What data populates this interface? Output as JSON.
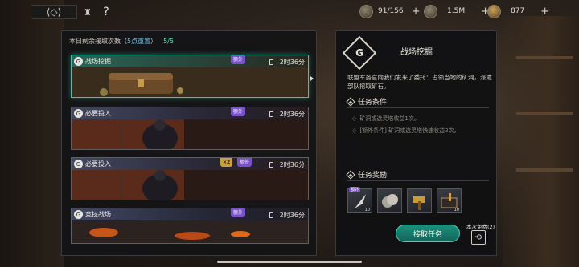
{
  "topbar": {
    "back_glyph": "⟨◇⟩",
    "home_glyph": "♜",
    "help_label": "?",
    "currencies": [
      {
        "value": "91/156",
        "icon": "energy-icon"
      },
      {
        "value": "1.5M",
        "icon": "silver-coin-icon"
      },
      {
        "value": "877",
        "icon": "gold-coin-icon"
      }
    ],
    "plus": "+"
  },
  "quota": {
    "prefix": "本日剩余接取次数（",
    "reset": "5点重置",
    "suffix": "）",
    "count": "5/5"
  },
  "missions": [
    {
      "title": "战场挖掘",
      "extra": "额外",
      "time": "2时36分",
      "active": true
    },
    {
      "title": "必要投入",
      "extra": "额外",
      "time": "2时36分",
      "active": false
    },
    {
      "title": "必要投入",
      "extra": "额外",
      "x2": "×2",
      "time": "2时36分",
      "active": false
    },
    {
      "title": "竞技战场",
      "extra": "额外",
      "time": "2时36分",
      "active": false
    }
  ],
  "detail": {
    "logo_letter": "G",
    "title": "战场挖掘",
    "description": "联盟军务官向我们发来了委托：占领当地的矿洞，派遣部队挖取矿石。",
    "conditions_title": "任务条件",
    "conditions": [
      {
        "mark": "◇",
        "text": "矿洞或选灵塔收益1次。"
      },
      {
        "mark": "◇",
        "text": "[额外条件] 矿洞或选灵塔快速收益2次。"
      }
    ],
    "rewards_title": "任务奖励",
    "rewards": [
      {
        "icon": "feather-item-icon",
        "count": "10",
        "tag": "额外"
      },
      {
        "icon": "coin-stack-icon",
        "count": "",
        "tag": ""
      },
      {
        "icon": "hammer-item-icon",
        "count": "",
        "tag": ""
      },
      {
        "icon": "weapon-box-icon",
        "count": "10",
        "tag": ""
      }
    ],
    "accept_label": "接取任务",
    "refresh_label": "本次免费(2)",
    "refresh_glyph": "⟲"
  },
  "colors": {
    "accent": "#3ec7a6",
    "extra_tag": "#7a52c8",
    "x2_tag": "#c8a13a",
    "quota_highlight": "#6fc1e6"
  }
}
